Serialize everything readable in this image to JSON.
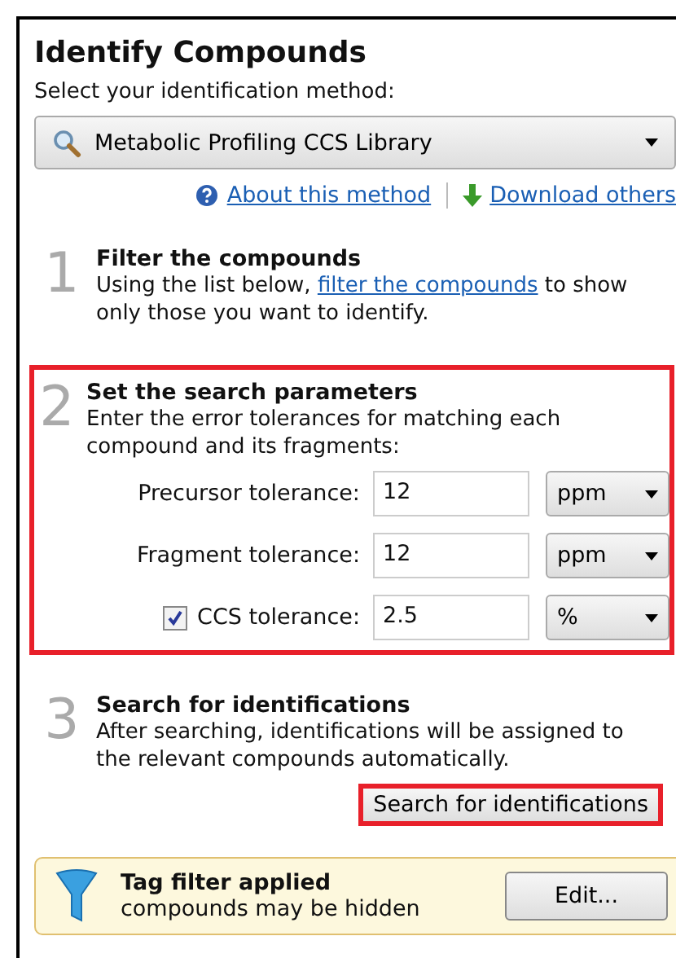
{
  "panel": {
    "title": "Identify Compounds",
    "method_label": "Select your identification method:",
    "method": "Metabolic Profiling CCS Library",
    "links": [
      {
        "kind": "help",
        "label": "About this method"
      },
      {
        "kind": "download",
        "label": "Download others"
      }
    ]
  },
  "steps": [
    {
      "number": "1",
      "title": "Filter the compounds",
      "highlighted": false,
      "description": [
        {
          "kind": "text",
          "text": "Using the list below, "
        },
        {
          "kind": "link",
          "text": "filter the compounds"
        },
        {
          "kind": "text",
          "text": " to show only those you want to identify."
        }
      ]
    },
    {
      "number": "2",
      "title": "Set the search parameters",
      "highlighted": true,
      "description": [
        {
          "kind": "text",
          "text": "Enter the error tolerances for matching each compound and its fragments:"
        }
      ],
      "parameters": [
        {
          "kind": "plain",
          "label": "Precursor tolerance:",
          "value": "12",
          "unit": "ppm"
        },
        {
          "kind": "plain",
          "label": "Fragment tolerance:",
          "value": "12",
          "unit": "ppm"
        },
        {
          "kind": "checkbox",
          "checked": true,
          "label": "CCS tolerance:",
          "value": "2.5",
          "unit": "%"
        }
      ]
    },
    {
      "number": "3",
      "title": "Search for identifications",
      "highlighted": false,
      "description": [
        {
          "kind": "text",
          "text": "After searching, identifications will be assigned to the relevant compounds automatically."
        }
      ],
      "button": {
        "label": "Search for identifications",
        "highlighted": true
      }
    }
  ],
  "notice": {
    "title": "Tag filter applied",
    "message": "compounds may be hidden",
    "button": "Edit..."
  }
}
